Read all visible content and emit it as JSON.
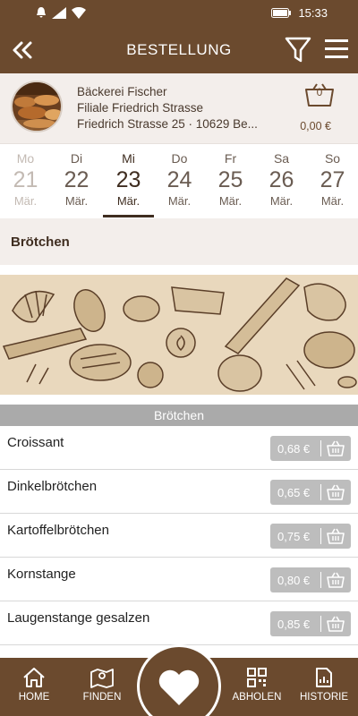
{
  "status_bar": {
    "time": "15:33"
  },
  "header": {
    "title": "BESTELLUNG"
  },
  "store": {
    "name": "Bäckerei Fischer",
    "branch": "Filiale Friedrich Strasse",
    "address": "Friedrich Strasse 25 · 10629 Be...",
    "cart_count": "0",
    "cart_total": "0,00 €"
  },
  "days": [
    {
      "name": "Mo",
      "num": "21",
      "month": "Mär."
    },
    {
      "name": "Di",
      "num": "22",
      "month": "Mär."
    },
    {
      "name": "Mi",
      "num": "23",
      "month": "Mär."
    },
    {
      "name": "Do",
      "num": "24",
      "month": "Mär."
    },
    {
      "name": "Fr",
      "num": "25",
      "month": "Mär."
    },
    {
      "name": "Sa",
      "num": "26",
      "month": "Mär."
    },
    {
      "name": "So",
      "num": "27",
      "month": "Mär."
    }
  ],
  "category": {
    "title": "Brötchen"
  },
  "section": {
    "title": "Brötchen"
  },
  "products": [
    {
      "name": "Croissant",
      "price": "0,68 €"
    },
    {
      "name": "Dinkelbrötchen",
      "price": "0,65 €"
    },
    {
      "name": "Kartoffelbrötchen",
      "price": "0,75 €"
    },
    {
      "name": "Kornstange",
      "price": "0,80 €"
    },
    {
      "name": "Laugenstange gesalzen",
      "price": "0,85 €"
    }
  ],
  "nav": {
    "home": "HOME",
    "finden": "FINDEN",
    "abholen": "ABHOLEN",
    "historie": "HISTORIE"
  },
  "colors": {
    "brand": "#6b4a2e",
    "banner": "#e9d8bd",
    "price_button": "#bdbdbd"
  }
}
